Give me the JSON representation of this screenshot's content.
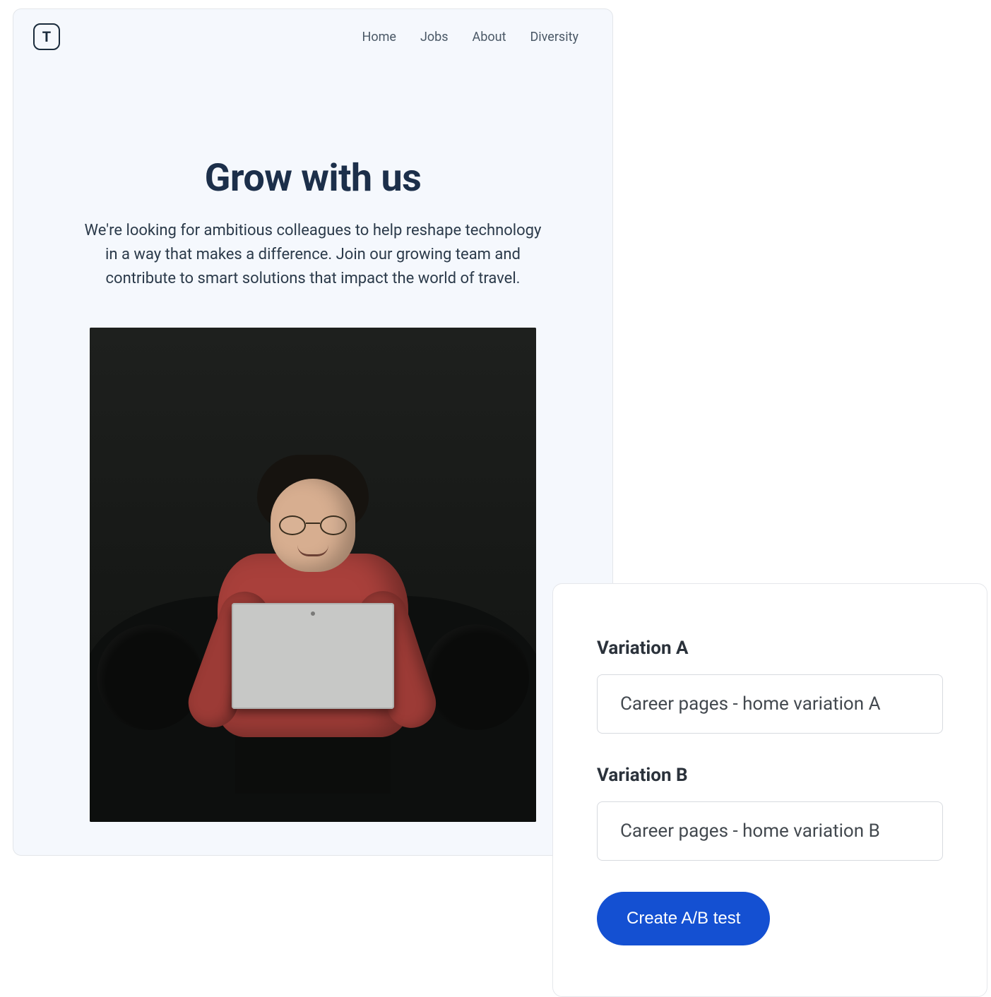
{
  "preview": {
    "logo_letter": "T",
    "nav": [
      "Home",
      "Jobs",
      "About",
      "Diversity"
    ],
    "hero_title": "Grow with us",
    "hero_subtitle": "We're looking for ambitious colleagues to help reshape technology in a way that makes a difference. Join our growing team and contribute to smart solutions that impact the world of travel."
  },
  "ab_panel": {
    "variation_a_label": "Variation A",
    "variation_a_value": "Career pages - home variation A",
    "variation_b_label": "Variation B",
    "variation_b_value": "Career pages - home variation B",
    "create_button": "Create A/B test"
  }
}
